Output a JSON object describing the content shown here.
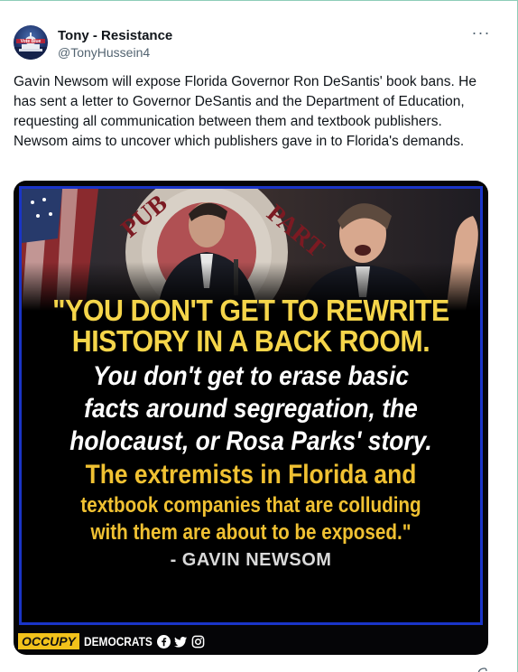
{
  "author": {
    "display_name": "Tony - Resistance",
    "handle": "@TonyHussein4",
    "avatar_icon": "vote-blue-capitol-avatar"
  },
  "more_icon_glyph": "···",
  "tweet_text": "Gavin Newsom will expose Florida Governor Ron DeSantis' book bans. He has sent a letter to Governor DeSantis and the Department of Education, requesting all communication between them and textbook publishers. Newsom aims to uncover which publishers gave in to Florida's demands.",
  "media": {
    "quote_line1": "\"YOU DON'T GET TO REWRITE",
    "quote_line2": "HISTORY IN A BACK ROOM.",
    "quote_line3": "You don't get to erase basic",
    "quote_line4": "facts around segregation, the",
    "quote_line5": "holocaust, or Rosa Parks' story.",
    "quote_line6": "The extremists in Florida and",
    "quote_line7": "textbook companies that are colluding",
    "quote_line8": "with them are about to be exposed.\"",
    "attribution": "- GAVIN NEWSOM",
    "brand_occupy": "OCCUPY",
    "brand_democrats": "DEMOCRATS",
    "social_icons": [
      "facebook-icon",
      "twitter-icon",
      "instagram-icon"
    ],
    "colors": {
      "border_blue": "#1a35c8",
      "headline_yellow": "#f5d54a",
      "body_yellow": "#f0c132",
      "brand_yellow": "#f2c21b"
    }
  }
}
